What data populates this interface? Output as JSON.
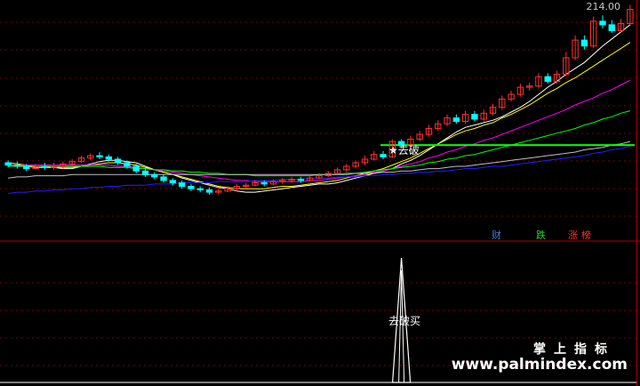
{
  "price_label": "214.00",
  "signal_text": "★去破",
  "indicator_label": "去破买",
  "badges": [
    {
      "text": "财",
      "color": "#3a7fd8"
    },
    {
      "text": "跌",
      "color": "#32cd32"
    },
    {
      "text": "涨",
      "color": "#ff3030"
    },
    {
      "text": "榜",
      "color": "#ff3030"
    }
  ],
  "watermark": {
    "title": "掌上指标",
    "url": "www.palmindex.com"
  },
  "colors": {
    "up": "#ff3030",
    "down": "#00ffff",
    "grid": "#800000"
  },
  "chart_data": [
    {
      "type": "candlestick",
      "title": "",
      "series": [
        {
          "kind": "ma",
          "color": "#ffffff",
          "values": [
            200.6,
            200.6,
            200.5,
            200.4,
            200.4,
            200.4,
            200.3,
            200.3,
            200.5,
            200.7,
            200.9,
            201,
            201,
            200.9,
            200.8,
            200.5,
            200.2,
            200,
            199.8,
            199.5,
            199.3,
            199.1,
            198.9,
            198.7,
            198.6,
            198.4,
            198.3,
            198.3,
            198.4,
            198.5,
            198.6,
            198.7,
            198.8,
            198.9,
            199,
            199,
            199.1,
            199.3,
            199.5,
            199.7,
            199.9,
            200.1,
            200.3,
            200.7,
            201,
            201.4,
            201.9,
            202.4,
            202.9,
            203.4,
            203.8,
            204,
            204.2,
            204.4,
            204.7,
            205.1,
            205.5,
            206,
            206.6,
            207.2,
            207.7,
            208.3,
            208.8,
            209.3,
            210,
            210.7,
            211.3,
            211.9,
            212.5
          ]
        },
        {
          "kind": "ma",
          "color": "#ffff00",
          "values": [
            200.8,
            200.7,
            200.6,
            200.5,
            200.5,
            200.4,
            200.4,
            200.4,
            200.5,
            200.6,
            200.7,
            200.8,
            200.8,
            200.7,
            200.6,
            200.4,
            200.2,
            200,
            199.8,
            199.6,
            199.4,
            199.2,
            199,
            198.8,
            198.7,
            198.6,
            198.6,
            198.6,
            198.6,
            198.7,
            198.8,
            198.8,
            198.9,
            199,
            199.1,
            199.2,
            199.3,
            199.5,
            199.7,
            199.9,
            200.1,
            200.3,
            200.6,
            200.9,
            201.2,
            201.6,
            202,
            202.4,
            202.8,
            203.2,
            203.5,
            203.7,
            204,
            204.2,
            204.6,
            204.9,
            205.3,
            205.7,
            206.2,
            206.7,
            207.1,
            207.6,
            208,
            208.5,
            209,
            209.5,
            210,
            210.5,
            211
          ]
        },
        {
          "kind": "ma",
          "color": "#ff00ff",
          "values": [
            200.6,
            200.6,
            200.6,
            200.6,
            200.6,
            200.6,
            200.6,
            200.6,
            200.6,
            200.6,
            200.6,
            200.6,
            200.5,
            200.5,
            200.4,
            200.3,
            200.2,
            200.1,
            200,
            199.9,
            199.8,
            199.7,
            199.6,
            199.5,
            199.4,
            199.3,
            199.3,
            199.2,
            199.2,
            199.2,
            199.2,
            199.2,
            199.2,
            199.3,
            199.3,
            199.4,
            199.5,
            199.6,
            199.7,
            199.8,
            200,
            200.1,
            200.3,
            200.5,
            200.7,
            200.9,
            201.2,
            201.4,
            201.7,
            201.9,
            202.2,
            202.4,
            202.7,
            202.9,
            203.2,
            203.5,
            203.8,
            204.1,
            204.4,
            204.7,
            205,
            205.3,
            205.7,
            206,
            206.3,
            206.7,
            207,
            207.4,
            207.8
          ]
        },
        {
          "kind": "ma",
          "color": "#00ff00",
          "values": [
            200.5,
            200.5,
            200.5,
            200.5,
            200.5,
            200.5,
            200.5,
            200.5,
            200.5,
            200.5,
            200.5,
            200.4,
            200.4,
            200.4,
            200.3,
            200.3,
            200.2,
            200.2,
            200.1,
            200.1,
            200,
            200,
            199.9,
            199.9,
            199.8,
            199.8,
            199.8,
            199.7,
            199.7,
            199.7,
            199.7,
            199.7,
            199.7,
            199.7,
            199.8,
            199.8,
            199.8,
            199.9,
            199.9,
            200,
            200.1,
            200.2,
            200.3,
            200.4,
            200.5,
            200.6,
            200.8,
            200.9,
            201.1,
            201.2,
            201.4,
            201.5,
            201.7,
            201.9,
            202.1,
            202.3,
            202.5,
            202.7,
            202.9,
            203.1,
            203.3,
            203.5,
            203.7,
            204,
            204.2,
            204.5,
            204.7,
            205,
            205.2
          ]
        },
        {
          "kind": "ma",
          "color": "#c0c0c0",
          "values": [
            199.5,
            199.6,
            199.6,
            199.7,
            199.7,
            199.7,
            199.7,
            199.8,
            199.8,
            199.8,
            199.8,
            199.8,
            199.8,
            199.8,
            199.8,
            199.8,
            199.8,
            199.8,
            199.8,
            199.8,
            199.8,
            199.8,
            199.8,
            199.8,
            199.8,
            199.8,
            199.8,
            199.8,
            199.8,
            199.8,
            199.8,
            199.8,
            199.8,
            199.8,
            199.8,
            199.8,
            199.8,
            199.8,
            199.9,
            199.9,
            199.9,
            200,
            200,
            200.1,
            200.1,
            200.2,
            200.3,
            200.3,
            200.4,
            200.5,
            200.5,
            200.6,
            200.7,
            200.8,
            200.9,
            201,
            201.1,
            201.2,
            201.3,
            201.4,
            201.5,
            201.6,
            201.7,
            201.9,
            202,
            202.1,
            202.3,
            202.4,
            202.6
          ]
        },
        {
          "kind": "ma",
          "color": "#2020ff",
          "values": [
            198.2,
            198.3,
            198.3,
            198.4,
            198.4,
            198.5,
            198.5,
            198.6,
            198.6,
            198.7,
            198.7,
            198.8,
            198.8,
            198.9,
            198.9,
            198.9,
            199,
            199,
            199,
            199.1,
            199.1,
            199.1,
            199.1,
            199.2,
            199.2,
            199.2,
            199.2,
            199.3,
            199.3,
            199.3,
            199.4,
            199.4,
            199.4,
            199.5,
            199.5,
            199.5,
            199.6,
            199.6,
            199.6,
            199.7,
            199.7,
            199.8,
            199.8,
            199.9,
            199.9,
            200,
            200,
            200.1,
            200.1,
            200.2,
            200.3,
            200.3,
            200.4,
            200.5,
            200.5,
            200.6,
            200.7,
            200.8,
            200.9,
            201,
            201.1,
            201.2,
            201.3,
            201.4,
            201.6,
            201.7,
            201.9,
            202,
            202.2
          ]
        }
      ],
      "candles": [
        [
          200.8,
          200.6,
          201,
          200.4
        ],
        [
          200.6,
          200.5,
          200.9,
          200.3
        ],
        [
          200.5,
          200.3,
          200.7,
          200.1
        ],
        [
          200.3,
          200.5,
          200.7,
          200.2
        ],
        [
          200.5,
          200.4,
          200.8,
          200.2
        ],
        [
          200.4,
          200.5,
          200.8,
          200.2
        ],
        [
          200.5,
          200.7,
          200.9,
          200.3
        ],
        [
          200.7,
          200.9,
          201.1,
          200.5
        ],
        [
          200.9,
          201.2,
          201.4,
          200.8
        ],
        [
          201.2,
          201.4,
          201.6,
          201
        ],
        [
          201.4,
          201.3,
          201.7,
          201.1
        ],
        [
          201.3,
          201.1,
          201.5,
          200.9
        ],
        [
          201.1,
          200.8,
          201.3,
          200.6
        ],
        [
          200.8,
          200.5,
          201,
          200.3
        ],
        [
          200.5,
          200.1,
          200.7,
          199.9
        ],
        [
          200.1,
          199.8,
          200.3,
          199.6
        ],
        [
          199.8,
          199.6,
          200,
          199.4
        ],
        [
          199.6,
          199.3,
          199.8,
          199.1
        ],
        [
          199.3,
          199.1,
          199.5,
          198.9
        ],
        [
          199.1,
          198.8,
          199.3,
          198.6
        ],
        [
          198.8,
          198.6,
          199,
          198.4
        ],
        [
          198.6,
          198.5,
          198.8,
          198.3
        ],
        [
          198.5,
          198.3,
          198.7,
          198.1
        ],
        [
          198.3,
          198.4,
          198.6,
          198.1
        ],
        [
          198.4,
          198.6,
          198.8,
          198.3
        ],
        [
          198.6,
          198.8,
          199,
          198.4
        ],
        [
          198.8,
          198.9,
          199.1,
          198.6
        ],
        [
          198.9,
          199.1,
          199.3,
          198.8
        ],
        [
          199.1,
          199,
          199.3,
          198.8
        ],
        [
          199,
          199.2,
          199.4,
          198.9
        ],
        [
          199.2,
          199.3,
          199.5,
          199
        ],
        [
          199.3,
          199.4,
          199.6,
          199.1
        ],
        [
          199.4,
          199.3,
          199.6,
          199.1
        ],
        [
          199.3,
          199.5,
          199.7,
          199.2
        ],
        [
          199.5,
          199.7,
          199.9,
          199.4
        ],
        [
          199.7,
          199.9,
          200.1,
          199.6
        ],
        [
          199.9,
          200.2,
          200.4,
          199.8
        ],
        [
          200.2,
          200.5,
          200.7,
          200
        ],
        [
          200.5,
          200.8,
          201,
          200.3
        ],
        [
          200.8,
          201.1,
          201.4,
          200.6
        ],
        [
          201.1,
          201.5,
          201.8,
          201
        ],
        [
          201.5,
          201.3,
          201.8,
          201.1
        ],
        [
          201.3,
          202.6,
          202.8,
          201.2
        ],
        [
          202.6,
          202.3,
          202.8,
          202
        ],
        [
          202.3,
          202.8,
          203.1,
          202.1
        ],
        [
          202.8,
          203.2,
          203.5,
          202.6
        ],
        [
          203.2,
          203.7,
          204,
          203
        ],
        [
          203.7,
          204.1,
          204.4,
          203.5
        ],
        [
          204.1,
          204.6,
          204.9,
          203.9
        ],
        [
          204.6,
          204.3,
          204.9,
          204.1
        ],
        [
          204.3,
          204.9,
          205.2,
          204.1
        ],
        [
          204.9,
          204.5,
          205.2,
          204.3
        ],
        [
          204.5,
          205,
          205.3,
          204.3
        ],
        [
          205,
          205.5,
          205.8,
          204.8
        ],
        [
          205.5,
          206.2,
          206.5,
          205.3
        ],
        [
          206.2,
          206.6,
          206.9,
          206
        ],
        [
          206.6,
          207.2,
          207.5,
          206.4
        ],
        [
          207.2,
          207.3,
          207.6,
          206.9
        ],
        [
          207.3,
          208.1,
          208.4,
          207.1
        ],
        [
          208.1,
          207.7,
          208.4,
          207.5
        ],
        [
          207.7,
          208.3,
          208.6,
          207.5
        ],
        [
          208.3,
          209.7,
          210.2,
          208.1
        ],
        [
          209.7,
          211.2,
          211.6,
          209.5
        ],
        [
          211.2,
          210.7,
          211.6,
          210.4
        ],
        [
          210.7,
          212.8,
          213.2,
          210.5
        ],
        [
          212.8,
          212.5,
          213.3,
          212.2
        ],
        [
          212.5,
          212,
          212.9,
          211.8
        ],
        [
          212,
          212.6,
          213,
          211.8
        ],
        [
          212.6,
          213.8,
          214.2,
          212.4
        ]
      ],
      "y_top": 214.6,
      "y_bottom": 196.5,
      "resistance_level": 202.3
    },
    {
      "type": "area",
      "title": "",
      "values": [
        0,
        0,
        0,
        0,
        0,
        0,
        0,
        0,
        0,
        0,
        0,
        0,
        0,
        0,
        0,
        0,
        0,
        0,
        0,
        0,
        0,
        0,
        0,
        0,
        0,
        0,
        0,
        0,
        0,
        0,
        0,
        0,
        0,
        0,
        0,
        0,
        0,
        0,
        0,
        0,
        0,
        0,
        0,
        1,
        0,
        0,
        0,
        0,
        0,
        0,
        0,
        0,
        0,
        0,
        0,
        0,
        0,
        0,
        0,
        0,
        0,
        0,
        0,
        0,
        0,
        0,
        0,
        0,
        0
      ],
      "ylim": [
        0,
        1
      ]
    }
  ]
}
